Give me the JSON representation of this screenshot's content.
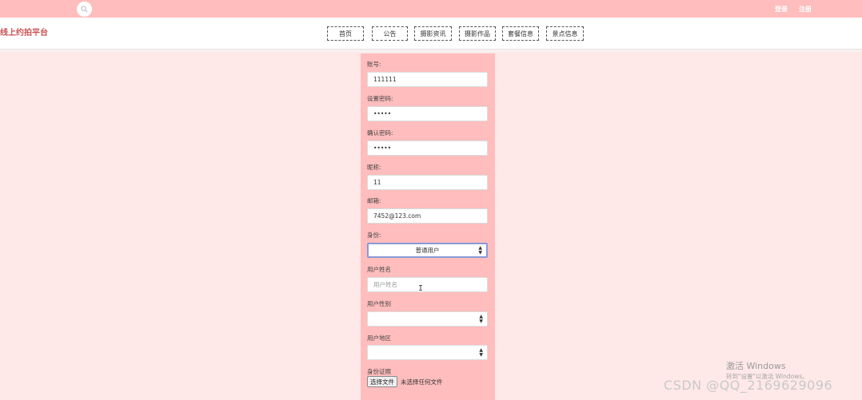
{
  "topbar": {
    "login_label": "登录",
    "register_label": "注册"
  },
  "header": {
    "site_title": "线上约拍平台",
    "nav": [
      {
        "label": "首页"
      },
      {
        "label": "公告"
      },
      {
        "label": "摄影资讯"
      },
      {
        "label": "摄影作品"
      },
      {
        "label": "套餐信息"
      },
      {
        "label": "景点信息"
      }
    ]
  },
  "form": {
    "account": {
      "label": "账号:",
      "value": "111111"
    },
    "password": {
      "label": "设置密码:",
      "value": "•••••"
    },
    "confirm_password": {
      "label": "确认密码:",
      "value": "•••••"
    },
    "nickname": {
      "label": "昵称:",
      "value": "11"
    },
    "email": {
      "label": "邮箱:",
      "value": "7452@123.com"
    },
    "identity": {
      "label": "身份:",
      "selected": "普通用户"
    },
    "user_name": {
      "label": "用户姓名",
      "placeholder": "用户姓名"
    },
    "user_gender": {
      "label": "用户性别",
      "selected": ""
    },
    "user_region": {
      "label": "用户地区",
      "selected": ""
    },
    "id_photo": {
      "label": "身份证照",
      "button_label": "选择文件",
      "status": "未选择任何文件"
    }
  },
  "watermark": {
    "title": "激活 Windows",
    "subtitle": "转到\"设置\"以激活 Windows。",
    "csdn": "CSDN @QQ_2169629096"
  },
  "colors": {
    "topbar": "#ffbdbd",
    "page_bg": "#ffe8e8",
    "panel_bg": "#ffbdbd",
    "title_color": "#c85454"
  },
  "icons": {
    "search": "search-icon",
    "select_arrow": "select-arrow-icon"
  }
}
